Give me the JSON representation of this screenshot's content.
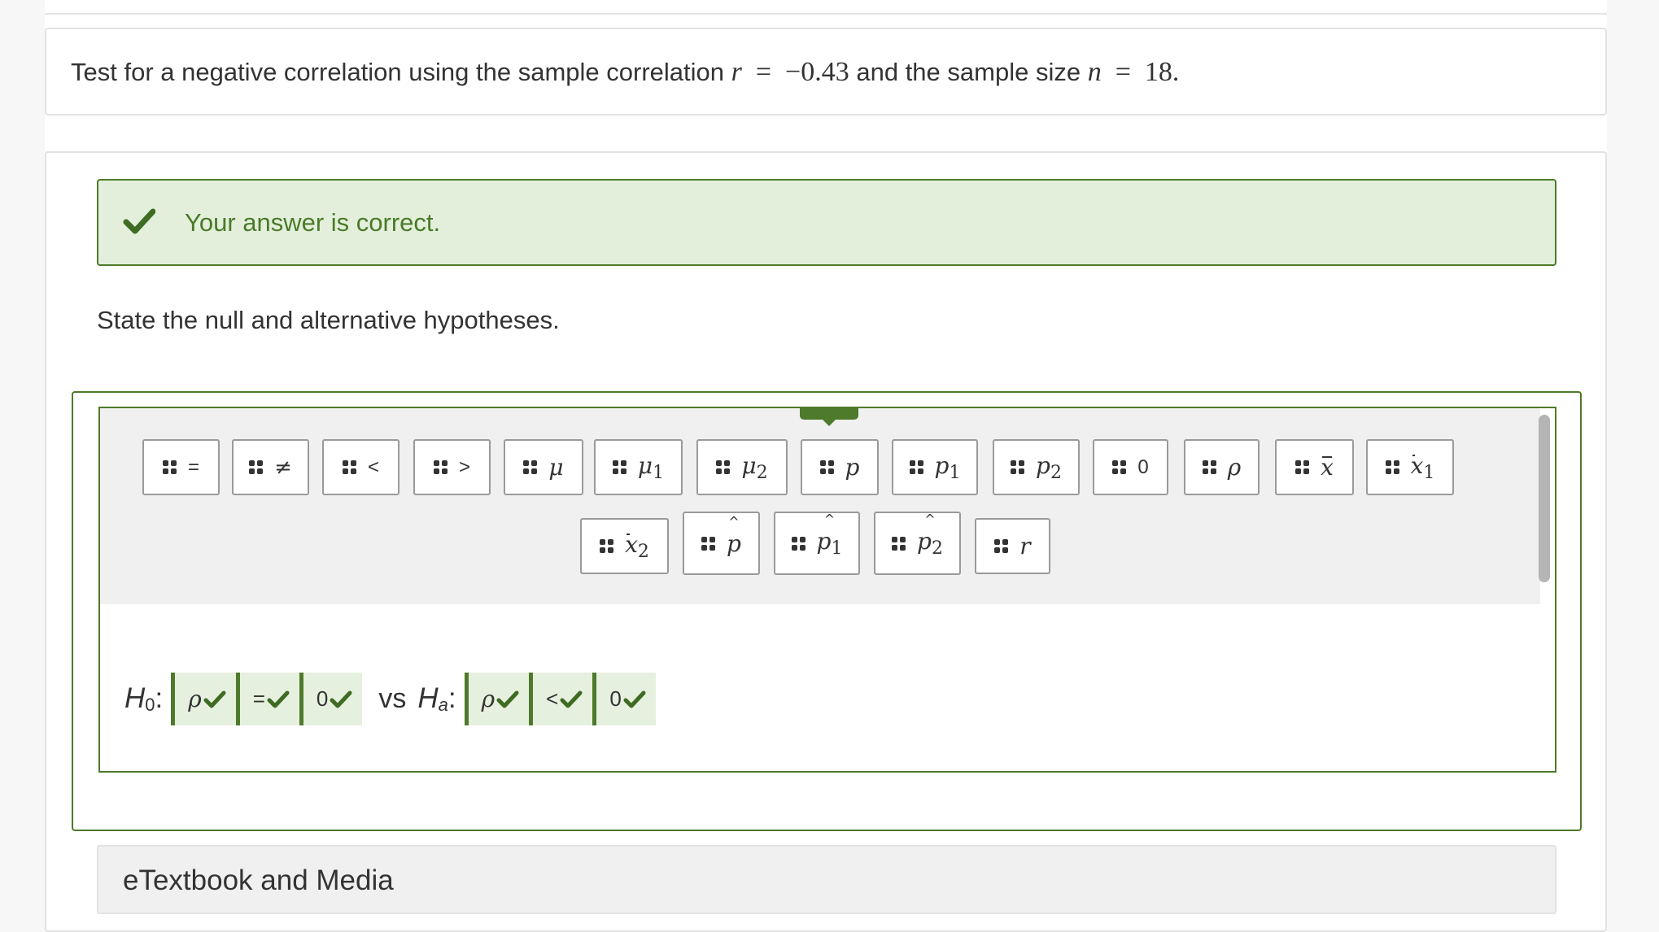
{
  "question": {
    "text_before": "Test for a negative correlation using the sample correlation",
    "r_symbol": "r",
    "equals": "=",
    "r_value": "−0.43",
    "text_middle": "and the sample size",
    "n_symbol": "n",
    "n_value": "18."
  },
  "feedback": {
    "message": "Your answer is correct.",
    "status_color": "#4e7a2b",
    "background_color": "#e3efdb"
  },
  "prompt": "State the null and alternative hypotheses.",
  "palette": {
    "row1": [
      {
        "label": "="
      },
      {
        "label": "≠"
      },
      {
        "label": "<"
      },
      {
        "label": ">"
      },
      {
        "label": "μ"
      },
      {
        "label": "μ",
        "sub": "1"
      },
      {
        "label": "μ",
        "sub": "2"
      },
      {
        "label": "p"
      },
      {
        "label": "p",
        "sub": "1"
      },
      {
        "label": "p",
        "sub": "2"
      },
      {
        "label": "0"
      },
      {
        "label": "ρ"
      },
      {
        "label": "x"
      },
      {
        "label": "x",
        "sub": "1"
      }
    ],
    "row2": [
      {
        "label": "x",
        "sub": "2"
      },
      {
        "label": "p"
      },
      {
        "label": "p",
        "sub": "1"
      },
      {
        "label": "p",
        "sub": "2"
      },
      {
        "label": "r"
      }
    ]
  },
  "hypotheses": {
    "h0_letter": "H",
    "h0_sub": "0",
    "colon": ":",
    "h0_parameter": "ρ",
    "h0_operator": "=",
    "h0_value": "0",
    "vs": "vs",
    "ha_letter": "H",
    "ha_sub": "a",
    "ha_parameter": "ρ",
    "ha_operator": "<",
    "ha_value": "0"
  },
  "etextbook": "eTextbook and Media"
}
